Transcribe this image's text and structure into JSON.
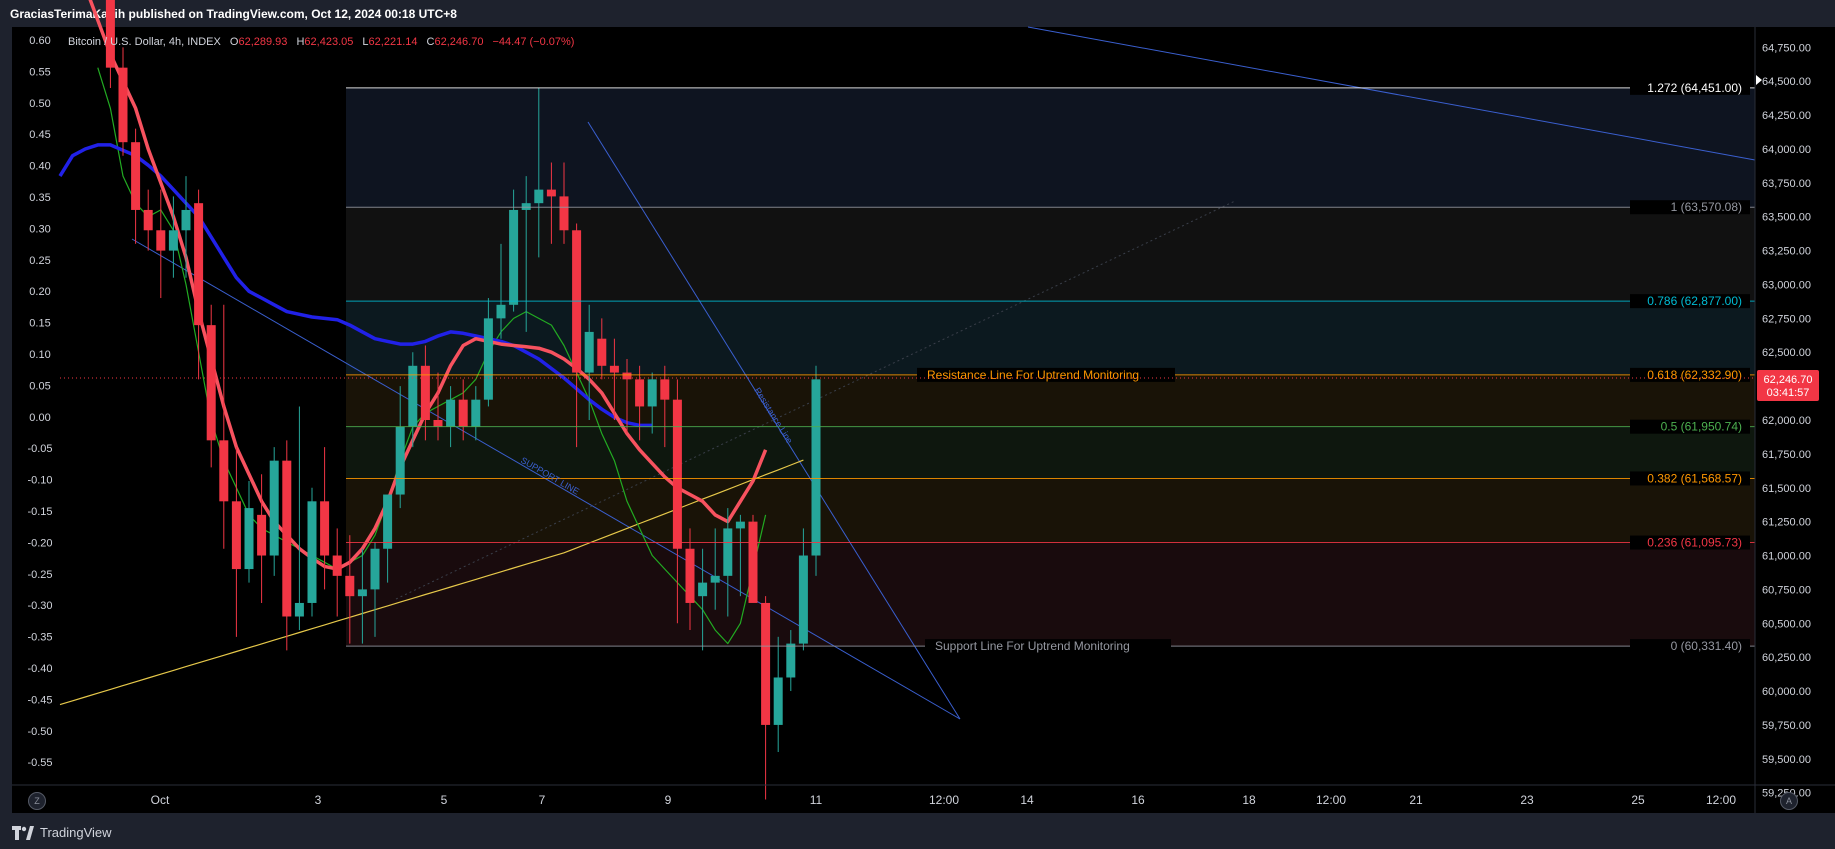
{
  "header": {
    "published_text": "GraciasTerimaKasih published on TradingView.com, Oct 12, 2024 00:18 UTC+8"
  },
  "legend": {
    "title": "Bitcoin / U.S. Dollar, 4h, INDEX",
    "open_label": "O",
    "open": "62,289.93",
    "high_label": "H",
    "high": "62,423.05",
    "low_label": "L",
    "low": "62,221.14",
    "close_label": "C",
    "close": "62,246.70",
    "change": "−44.47 (−0.07%)"
  },
  "price_tag": {
    "price": "62,246.70",
    "countdown": "03:41:57"
  },
  "footer": {
    "brand": "TradingView",
    "left_button": "Z",
    "right_button": "A"
  },
  "colors": {
    "up": "#26a69a",
    "down": "#f23645",
    "ema_red": "#f7525f",
    "ema_blue": "#2121e8",
    "ema_green": "#22ab22",
    "ema_yellow": "#e6c84a"
  },
  "chart_data": {
    "type": "candlestick",
    "left_axis": {
      "ticks": [
        "0.60",
        "0.55",
        "0.50",
        "0.45",
        "0.40",
        "0.35",
        "0.30",
        "0.25",
        "0.20",
        "0.15",
        "0.10",
        "0.05",
        "0.00",
        "-0.05",
        "-0.10",
        "-0.15",
        "-0.20",
        "-0.25",
        "-0.30",
        "-0.35",
        "-0.40",
        "-0.45",
        "-0.50",
        "-0.55"
      ]
    },
    "right_axis": {
      "ylim": [
        59100,
        64900
      ],
      "ticks": [
        "64,750.00",
        "64,500.00",
        "64,250.00",
        "64,000.00",
        "63,750.00",
        "63,500.00",
        "63,250.00",
        "63,000.00",
        "62,750.00",
        "62,500.00",
        "62,250.00",
        "62,000.00",
        "61,750.00",
        "61,500.00",
        "61,250.00",
        "61,000.00",
        "60,750.00",
        "60,500.00",
        "60,250.00",
        "60,000.00",
        "59,750.00",
        "59,500.00",
        "59,250.00"
      ]
    },
    "x_ticks": [
      "Oct",
      "3",
      "5",
      "7",
      "9",
      "11",
      "12:00",
      "14",
      "16",
      "18",
      "12:00",
      "21",
      "23",
      "25",
      "12:00"
    ],
    "fib_levels": [
      {
        "ratio": "1.272",
        "price": 64451.0,
        "label": "1.272 (64,451.00)",
        "color": "#ffffff"
      },
      {
        "ratio": "1",
        "price": 63570.08,
        "label": "1 (63,570.08)",
        "color": "#9598a1"
      },
      {
        "ratio": "0.786",
        "price": 62877.0,
        "label": "0.786 (62,877.00)",
        "color": "#00bcd4"
      },
      {
        "ratio": "0.618",
        "price": 62332.9,
        "label": "0.618 (62,332.90)",
        "color": "#ff9800"
      },
      {
        "ratio": "0.5",
        "price": 61950.74,
        "label": "0.5 (61,950.74)",
        "color": "#4caf50"
      },
      {
        "ratio": "0.382",
        "price": 61568.57,
        "label": "0.382 (61,568.57)",
        "color": "#ff9800"
      },
      {
        "ratio": "0.236",
        "price": 61095.73,
        "label": "0.236 (61,095.73)",
        "color": "#f23645"
      },
      {
        "ratio": "0",
        "price": 60331.4,
        "label": "0 (60,331.40)",
        "color": "#9598a1"
      }
    ],
    "annotations": {
      "resistance_text": "Resistance Line For Uptrend Monitoring",
      "support_text": "Support Line For Uptrend Monitoring",
      "support_line_label": "SUPPORT LINE",
      "resistance_line_label": "Resistance Line"
    },
    "candles": [
      [
        65100,
        65250,
        64450,
        64600
      ],
      [
        64600,
        64750,
        63950,
        64050
      ],
      [
        64050,
        64150,
        63300,
        63550
      ],
      [
        63550,
        63700,
        63250,
        63400
      ],
      [
        63400,
        63700,
        62900,
        63250
      ],
      [
        63250,
        63650,
        63050,
        63400
      ],
      [
        63400,
        63800,
        63050,
        63550
      ],
      [
        63600,
        63700,
        62300,
        62700
      ],
      [
        62700,
        62850,
        61650,
        61850
      ],
      [
        61850,
        62850,
        61050,
        61400
      ],
      [
        61400,
        61800,
        60400,
        60900
      ],
      [
        60900,
        61550,
        60800,
        61350
      ],
      [
        61300,
        61600,
        60650,
        61000
      ],
      [
        61000,
        61800,
        60850,
        61700
      ],
      [
        61700,
        61850,
        60300,
        60550
      ],
      [
        60550,
        62100,
        60450,
        60650
      ],
      [
        60650,
        61500,
        60550,
        61400
      ],
      [
        61400,
        61800,
        60750,
        61000
      ],
      [
        61000,
        61200,
        60550,
        60850
      ],
      [
        60850,
        61150,
        60350,
        60700
      ],
      [
        60700,
        61050,
        60350,
        60750
      ],
      [
        60750,
        61100,
        60400,
        61050
      ],
      [
        61050,
        61450,
        60800,
        61450
      ],
      [
        61450,
        62250,
        61350,
        61950
      ],
      [
        61950,
        62500,
        61800,
        62400
      ],
      [
        62400,
        62550,
        61850,
        62000
      ],
      [
        62000,
        62350,
        61850,
        61950
      ],
      [
        61950,
        62250,
        61800,
        62150
      ],
      [
        62150,
        62300,
        61850,
        61950
      ],
      [
        61950,
        62250,
        61850,
        62150
      ],
      [
        62150,
        62900,
        62100,
        62750
      ],
      [
        62750,
        63300,
        62600,
        62850
      ],
      [
        62850,
        63700,
        62800,
        63550
      ],
      [
        63550,
        63800,
        62650,
        63600
      ],
      [
        63600,
        64450,
        63200,
        63700
      ],
      [
        63700,
        63900,
        63300,
        63650
      ],
      [
        63650,
        63900,
        63300,
        63400
      ],
      [
        63400,
        63450,
        61800,
        62350
      ],
      [
        62350,
        62850,
        62000,
        62650
      ],
      [
        62600,
        62750,
        62300,
        62400
      ],
      [
        62400,
        62600,
        62000,
        62350
      ],
      [
        62350,
        62450,
        61900,
        62300
      ],
      [
        62300,
        62400,
        61850,
        62100
      ],
      [
        62100,
        62350,
        61900,
        62300
      ],
      [
        62300,
        62400,
        61800,
        62150
      ],
      [
        62150,
        62300,
        60500,
        61050
      ],
      [
        61050,
        61200,
        60450,
        60650
      ],
      [
        60700,
        61050,
        60300,
        60800
      ],
      [
        60800,
        61200,
        60600,
        60850
      ],
      [
        60850,
        61350,
        60550,
        61200
      ],
      [
        61200,
        61300,
        60700,
        61250
      ],
      [
        61250,
        61300,
        60850,
        60650
      ],
      [
        60650,
        60700,
        59200,
        59750
      ],
      [
        59750,
        60400,
        59550,
        60100
      ],
      [
        60100,
        60450,
        60000,
        60350
      ],
      [
        60350,
        61200,
        60300,
        61000
      ],
      [
        61000,
        62400,
        60850,
        62300
      ]
    ],
    "ema_red": [
      65200,
      64950,
      64700,
      64500,
      64300,
      64000,
      63750,
      63500,
      63200,
      62800,
      62450,
      62100,
      61800,
      61600,
      61400,
      61250,
      61150,
      61050,
      60980,
      60920,
      60900,
      60950,
      61050,
      61200,
      61400,
      61650,
      61850,
      62050,
      62200,
      62400,
      62550,
      62600,
      62580,
      62560,
      62550,
      62540,
      62530,
      62500,
      62450,
      62380,
      62300,
      62200,
      62050,
      61900,
      61780,
      61680,
      61580,
      61500,
      61450,
      61400,
      61300,
      61250,
      61400,
      61550,
      61780
    ],
    "ema_blue": [
      63800,
      63950,
      64000,
      64030,
      64030,
      63990,
      63950,
      63880,
      63800,
      63700,
      63600,
      63500,
      63350,
      63200,
      63050,
      62950,
      62900,
      62850,
      62800,
      62780,
      62760,
      62750,
      62740,
      62700,
      62650,
      62600,
      62580,
      62560,
      62560,
      62580,
      62620,
      62650,
      62640,
      62620,
      62600,
      62580,
      62550,
      62500,
      62450,
      62380,
      62310,
      62230,
      62150,
      62080,
      62020,
      61980,
      61960,
      61960
    ],
    "ema_green": [
      64600,
      64300,
      63800,
      63600,
      63500,
      63550,
      63400,
      63000,
      62500,
      62000,
      61700,
      61500,
      61300,
      61200,
      61150,
      61100,
      61050,
      61000,
      60950,
      60900,
      60950,
      61000,
      61150,
      61400,
      61700,
      61950,
      62050,
      62100,
      62150,
      62200,
      62300,
      62500,
      62650,
      62750,
      62800,
      62750,
      62700,
      62550,
      62350,
      62150,
      61900,
      61700,
      61400,
      61200,
      61000,
      60900,
      60800,
      60700,
      60600,
      60450,
      60350,
      60500,
      60900,
      61300
    ]
  }
}
